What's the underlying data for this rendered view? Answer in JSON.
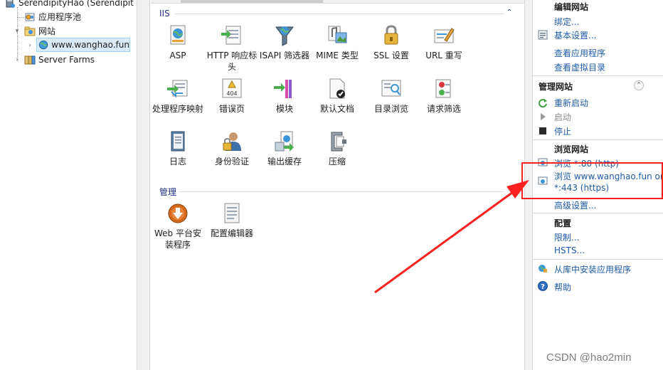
{
  "tree": {
    "server_label": "SerendipityHao (Serendipit",
    "app_pools_label": "应用程序池",
    "sites_label": "网站",
    "site_label": "www.wanghao.fun",
    "server_farms_label": "Server Farms"
  },
  "groups": {
    "iis_title": "IIS",
    "manage_title": "管理"
  },
  "features": {
    "asp": "ASP",
    "http_headers": "HTTP 响应标头",
    "isapi_filters": "ISAPI 筛选器",
    "mime_types": "MIME 类型",
    "ssl": "SSL 设置",
    "url_rewrite": "URL 重写",
    "handler_mappings": "处理程序映射",
    "error_pages": "错误页",
    "modules": "模块",
    "default_doc": "默认文档",
    "dir_browsing": "目录浏览",
    "request_filtering": "请求筛选",
    "logging": "日志",
    "authentication": "身份验证",
    "output_caching": "输出缓存",
    "compression": "压缩",
    "web_platform": "Web 平台安装程序",
    "config_editor": "配置编辑器"
  },
  "actions": {
    "edit_site_head": "编辑网站",
    "bindings": "绑定...",
    "basic_settings": "基本设置...",
    "view_apps": "查看应用程序",
    "view_vdirs": "查看虚拟目录",
    "manage_site_head": "管理网站",
    "restart": "重新启动",
    "start": "启动",
    "stop": "停止",
    "browse_site_head": "浏览网站",
    "browse_80": "浏览 *:80 (http)",
    "browse_443_line1": "浏览 www.wanghao.fun on",
    "browse_443_line2": "*:443 (https)",
    "advanced_settings": "高级设置...",
    "config_head": "配置",
    "limits": "限制...",
    "hsts": "HSTS...",
    "install_app": "从库中安装应用程序",
    "help": "帮助"
  },
  "watermark": "CSDN @hao2min",
  "colors": {
    "link": "#1e5ba8",
    "group_title": "#1e3287",
    "annotation": "#ff2020",
    "selection": "#d9ebf9"
  }
}
